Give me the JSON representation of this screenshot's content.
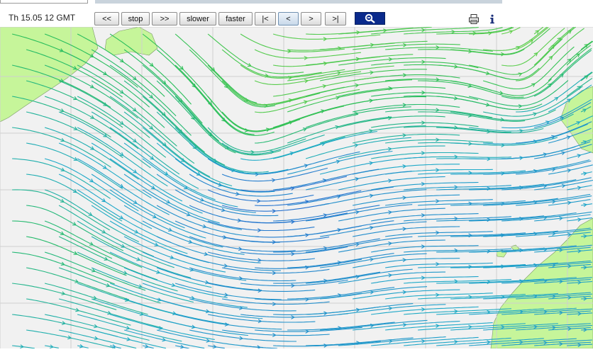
{
  "toolbar": {
    "timestamp": "Th 15.05 12 GMT",
    "buttons": {
      "rewind": "<<",
      "stop": "stop",
      "forward": ">>",
      "slower": "slower",
      "faster": "faster",
      "first": "|<",
      "prev": "<",
      "next": ">",
      "last": ">|"
    }
  },
  "icons": {
    "zoom": "magnifier-icon",
    "print": "printer-icon",
    "info": "info-icon"
  },
  "colors": {
    "sea": "#f1f1f1",
    "land": "#c6f59a",
    "grid": "#cfcfcf",
    "zoom_button": "#0a2a8c"
  }
}
